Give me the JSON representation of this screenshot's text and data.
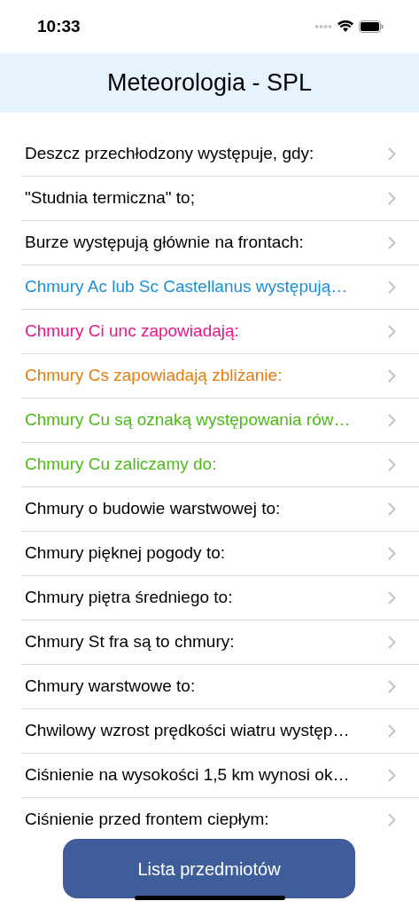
{
  "status_bar": {
    "time": "10:33"
  },
  "header": {
    "title": "Meteorologia - SPL"
  },
  "questions": [
    {
      "text": "Deszcz przechłodzony występuje, gdy:",
      "color": "#000000"
    },
    {
      "text": "\"Studnia termiczna\" to;",
      "color": "#000000"
    },
    {
      "text": "Burze występują głównie na frontach:",
      "color": "#000000"
    },
    {
      "text": "Chmury Ac lub Sc Castellanus występują…",
      "color": "#1a8fd6"
    },
    {
      "text": "Chmury Ci unc zapowiadają:",
      "color": "#e8168a"
    },
    {
      "text": "Chmury Cs zapowiadają zbliżanie:",
      "color": "#e37d0f"
    },
    {
      "text": "Chmury Cu są oznaką występowania rów…",
      "color": "#4cba16"
    },
    {
      "text": "Chmury Cu zaliczamy do:",
      "color": "#4cba16"
    },
    {
      "text": "Chmury o budowie warstwowej to:",
      "color": "#000000"
    },
    {
      "text": "Chmury pięknej pogody to:",
      "color": "#000000"
    },
    {
      "text": "Chmury piętra średniego to:",
      "color": "#000000"
    },
    {
      "text": "Chmury St fra są to chmury:",
      "color": "#000000"
    },
    {
      "text": "Chmury warstwowe to:",
      "color": "#000000"
    },
    {
      "text": "Chwilowy wzrost prędkości wiatru występ…",
      "color": "#000000"
    },
    {
      "text": "Ciśnienie na wysokości 1,5 km wynosi ok…",
      "color": "#000000"
    },
    {
      "text": "Ciśnienie przed frontem ciepłym:",
      "color": "#000000"
    }
  ],
  "bottom_button": {
    "label": "Lista przedmiotów"
  }
}
